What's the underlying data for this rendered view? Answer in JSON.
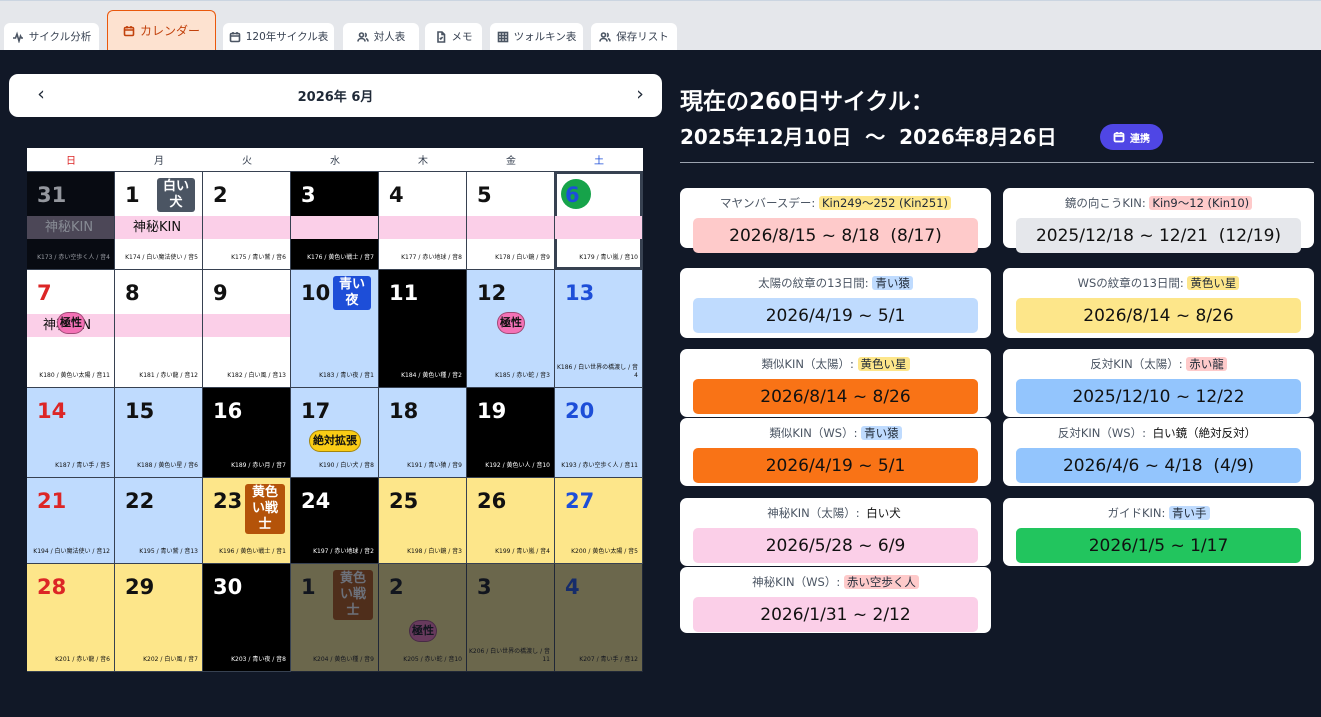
{
  "tabs": [
    {
      "label": "サイクル分析",
      "icon": "activity-icon"
    },
    {
      "label": "カレンダー",
      "icon": "calendar-icon",
      "active": true
    },
    {
      "label": "120年サイクル表",
      "icon": "calendar-icon"
    },
    {
      "label": "対人表",
      "icon": "users-icon"
    },
    {
      "label": "メモ",
      "icon": "file-icon"
    },
    {
      "label": "ツォルキン表",
      "icon": "grid-icon"
    },
    {
      "label": "保存リスト",
      "icon": "users-icon"
    }
  ],
  "calendar": {
    "month_title": "2026年 6月",
    "prev_label": "‹",
    "next_label": "›",
    "weekdays": [
      "日",
      "月",
      "火",
      "水",
      "木",
      "金",
      "土"
    ],
    "days": [
      {
        "d": "31",
        "kin": "K173 / 赤い空歩く人 / 音4",
        "bg": "#000000",
        "fg": "#ffffff",
        "band": "神秘KIN",
        "dim": true
      },
      {
        "d": "1",
        "kin": "K174 / 白い魔法使い / 音5",
        "bg": "#ffffff",
        "fg": "#111111",
        "badge": "白い\n犬",
        "badge_bg": "#4b5563",
        "band": "神秘KIN"
      },
      {
        "d": "2",
        "kin": "K175 / 青い鷲 / 音6",
        "bg": "#ffffff",
        "fg": "#111111",
        "band": ""
      },
      {
        "d": "3",
        "kin": "K176 / 黄色い戦士 / 音7",
        "bg": "#000000",
        "fg": "#ffffff",
        "band": ""
      },
      {
        "d": "4",
        "kin": "K177 / 赤い地球 / 音8",
        "bg": "#ffffff",
        "fg": "#111111",
        "band": ""
      },
      {
        "d": "5",
        "kin": "K178 / 白い鏡 / 音9",
        "bg": "#ffffff",
        "fg": "#111111",
        "band": ""
      },
      {
        "d": "6",
        "kin": "K179 / 青い嵐 / 音10",
        "bg": "#ffffff",
        "fg": "#1d4ed8",
        "today": true,
        "band": ""
      },
      {
        "d": "7",
        "kin": "K180 / 黄色い太陽 / 音11",
        "bg": "#ffffff",
        "fg": "#dc2626",
        "pill": "極性",
        "band": "神秘KIN"
      },
      {
        "d": "8",
        "kin": "K181 / 赤い龍 / 音12",
        "bg": "#ffffff",
        "fg": "#111111",
        "band": ""
      },
      {
        "d": "9",
        "kin": "K182 / 白い風 / 音13",
        "bg": "#ffffff",
        "fg": "#111111",
        "band": ""
      },
      {
        "d": "10",
        "kin": "K183 / 青い夜 / 音1",
        "bg": "#bfdbfe",
        "fg": "#111111",
        "badge": "青い\n夜",
        "badge_bg": "#1d4ed8"
      },
      {
        "d": "11",
        "kin": "K184 / 黄色い種 / 音2",
        "bg": "#000000",
        "fg": "#ffffff"
      },
      {
        "d": "12",
        "kin": "K185 / 赤い蛇 / 音3",
        "bg": "#bfdbfe",
        "fg": "#111111",
        "pill": "極性"
      },
      {
        "d": "13",
        "kin": "K186 / 白い世界の橋渡し / 音4",
        "bg": "#bfdbfe",
        "fg": "#1d4ed8"
      },
      {
        "d": "14",
        "kin": "K187 / 青い手 / 音5",
        "bg": "#bfdbfe",
        "fg": "#dc2626"
      },
      {
        "d": "15",
        "kin": "K188 / 黄色い星 / 音6",
        "bg": "#bfdbfe",
        "fg": "#111111"
      },
      {
        "d": "16",
        "kin": "K189 / 赤い月 / 音7",
        "bg": "#000000",
        "fg": "#ffffff"
      },
      {
        "d": "17",
        "kin": "K190 / 白い犬 / 音8",
        "bg": "#bfdbfe",
        "fg": "#111111",
        "pill": "絶対拡張",
        "pill_bg": "#facc15"
      },
      {
        "d": "18",
        "kin": "K191 / 青い猿 / 音9",
        "bg": "#bfdbfe",
        "fg": "#111111"
      },
      {
        "d": "19",
        "kin": "K192 / 黄色い人 / 音10",
        "bg": "#000000",
        "fg": "#ffffff"
      },
      {
        "d": "20",
        "kin": "K193 / 赤い空歩く人 / 音11",
        "bg": "#bfdbfe",
        "fg": "#1d4ed8"
      },
      {
        "d": "21",
        "kin": "K194 / 白い魔法使い / 音12",
        "bg": "#bfdbfe",
        "fg": "#dc2626"
      },
      {
        "d": "22",
        "kin": "K195 / 青い鷲 / 音13",
        "bg": "#bfdbfe",
        "fg": "#111111"
      },
      {
        "d": "23",
        "kin": "K196 / 黄色い戦士 / 音1",
        "bg": "#fde68a",
        "fg": "#111111",
        "badge": "黄色\nい戦\n士",
        "badge_bg": "#b45309"
      },
      {
        "d": "24",
        "kin": "K197 / 赤い地球 / 音2",
        "bg": "#000000",
        "fg": "#ffffff"
      },
      {
        "d": "25",
        "kin": "K198 / 白い鏡 / 音3",
        "bg": "#fde68a",
        "fg": "#111111"
      },
      {
        "d": "26",
        "kin": "K199 / 青い嵐 / 音4",
        "bg": "#fde68a",
        "fg": "#111111"
      },
      {
        "d": "27",
        "kin": "K200 / 黄色い太陽 / 音5",
        "bg": "#fde68a",
        "fg": "#1d4ed8"
      },
      {
        "d": "28",
        "kin": "K201 / 赤い龍 / 音6",
        "bg": "#fde68a",
        "fg": "#dc2626"
      },
      {
        "d": "29",
        "kin": "K202 / 白い風 / 音7",
        "bg": "#fde68a",
        "fg": "#111111"
      },
      {
        "d": "30",
        "kin": "K203 / 青い夜 / 音8",
        "bg": "#000000",
        "fg": "#ffffff"
      },
      {
        "d": "1",
        "kin": "K204 / 黄色い種 / 音9",
        "bg": "#fde68a",
        "fg": "#111111",
        "badge": "黄色\nい戦\n士",
        "badge_bg": "#b45309",
        "dim": true
      },
      {
        "d": "2",
        "kin": "K205 / 赤い蛇 / 音10",
        "bg": "#fde68a",
        "fg": "#111111",
        "pill": "極性",
        "dim": true
      },
      {
        "d": "3",
        "kin": "K206 / 白い世界の橋渡し / 音11",
        "bg": "#fde68a",
        "fg": "#111111",
        "dim": true
      },
      {
        "d": "4",
        "kin": "K207 / 青い手 / 音12",
        "bg": "#fde68a",
        "fg": "#1d4ed8",
        "dim": true
      }
    ]
  },
  "cycle": {
    "title": "現在の260日サイクル：",
    "range": "2025年12月10日  〜  2026年8月26日",
    "sync_label": "連携"
  },
  "cards": [
    {
      "label": "マヤンバースデー:",
      "chip": "Kin249〜252 (Kin251)",
      "chip_bg": "#fde68a",
      "value": "2026/8/15 ~ 8/18  (8/17)",
      "value_bg": "#fecaca"
    },
    {
      "label": "鏡の向こうKIN:",
      "chip": "Kin9〜12 (Kin10)",
      "chip_bg": "#fecaca",
      "value": "2025/12/18 ~ 12/21  (12/19)",
      "value_bg": "#e5e7eb"
    },
    {
      "label": "太陽の紋章の13日間:",
      "chip": "青い猿",
      "chip_bg": "#bfdbfe",
      "value": "2026/4/19 ~ 5/1",
      "value_bg": "#bfdbfe"
    },
    {
      "label": "WSの紋章の13日間:",
      "chip": "黄色い星",
      "chip_bg": "#fde68a",
      "value": "2026/8/14 ~ 8/26",
      "value_bg": "#fde68a"
    },
    {
      "label": "類似KIN（太陽）:",
      "chip": "黄色い星",
      "chip_bg": "#fde68a",
      "value": "2026/8/14 ~ 8/26",
      "value_bg": "#f97316"
    },
    {
      "label": "反対KIN（太陽）:",
      "chip": "赤い龍",
      "chip_bg": "#fecaca",
      "value": "2025/12/10 ~ 12/22",
      "value_bg": "#93c5fd"
    },
    {
      "label": "類似KIN（WS）:",
      "chip": "青い猿",
      "chip_bg": "#bfdbfe",
      "value": "2026/4/19 ~ 5/1",
      "value_bg": "#f97316"
    },
    {
      "label": "反対KIN（WS）:",
      "chip": "白い鏡（絶対反対）",
      "chip_bg": "",
      "value": "2026/4/6 ~ 4/18  (4/9)",
      "value_bg": "#93c5fd"
    },
    {
      "label": "神秘KIN（太陽）:",
      "chip": "白い犬",
      "chip_bg": "",
      "value": "2026/5/28 ~ 6/9",
      "value_bg": "#fbcfe8"
    },
    {
      "label": "ガイドKIN:",
      "chip": "青い手",
      "chip_bg": "#bfdbfe",
      "value": "2026/1/5 ~ 1/17",
      "value_bg": "#22c55e"
    },
    {
      "label": "神秘KIN（WS）:",
      "chip": "赤い空歩く人",
      "chip_bg": "#fecaca",
      "value": "2026/1/31 ~ 2/12",
      "value_bg": "#fbcfe8"
    }
  ]
}
